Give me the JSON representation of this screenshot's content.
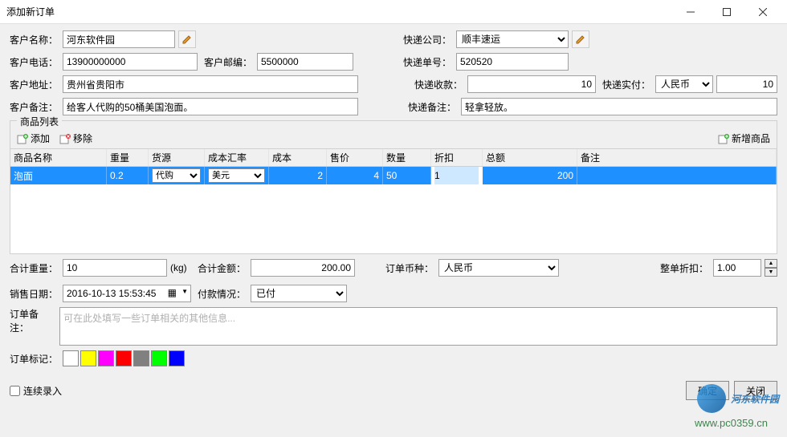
{
  "window": {
    "title": "添加新订单"
  },
  "customer": {
    "name_label": "客户名称：",
    "name": "河东软件园",
    "phone_label": "客户电话：",
    "phone": "13900000000",
    "zip_label": "客户邮编：",
    "zip": "5500000",
    "addr_label": "客户地址：",
    "addr": "贵州省贵阳市",
    "note_label": "客户备注：",
    "note": "给客人代购的50桶美国泡面。"
  },
  "courier": {
    "company_label": "快递公司：",
    "company": "顺丰速运",
    "trackno_label": "快递单号：",
    "trackno": "520520",
    "collect_label": "快递收款：",
    "collect": "10",
    "paid_label": "快递实付：",
    "currency": "人民币",
    "paid": "10",
    "note_label": "快递备注：",
    "note": "轻拿轻放。"
  },
  "product": {
    "group_label": "商品列表",
    "add_label": "添加",
    "remove_label": "移除",
    "newprod_label": "新增商品",
    "headers": {
      "name": "商品名称",
      "weight": "重量",
      "source": "货源",
      "cost_rate": "成本汇率",
      "cost": "成本",
      "price": "售价",
      "qty": "数量",
      "discount": "折扣",
      "total": "总额",
      "note": "备注"
    },
    "rows": [
      {
        "name": "泡面",
        "weight": "0.2",
        "source": "代购",
        "cost_rate": "美元",
        "cost": "2",
        "price": "4",
        "qty": "50",
        "discount": "1",
        "total": "200",
        "note": ""
      }
    ]
  },
  "summary": {
    "weight_label": "合计重量：",
    "weight": "10",
    "weight_unit": "(kg)",
    "amount_label": "合计金额：",
    "amount": "200.00",
    "currency_label": "订单币种：",
    "currency": "人民币",
    "discount_label": "整单折扣：",
    "discount": "1.00"
  },
  "sale": {
    "date_label": "销售日期：",
    "date": "2016-10-13 15:53:45",
    "pay_label": "付款情况：",
    "pay_status": "已付"
  },
  "order_note": {
    "label": "订单备注：",
    "placeholder": "可在此处填写一些订单相关的其他信息..."
  },
  "order_tag": {
    "label": "订单标记：",
    "colors": [
      "#ffffff",
      "#ffff00",
      "#ff00ff",
      "#ff0000",
      "#808080",
      "#00ff00",
      "#0000ff"
    ]
  },
  "continuous_label": "连续录入",
  "buttons": {
    "ok": "确定",
    "close": "关闭"
  },
  "watermark": {
    "text": "河东软件园",
    "url": "www.pc0359.cn"
  }
}
